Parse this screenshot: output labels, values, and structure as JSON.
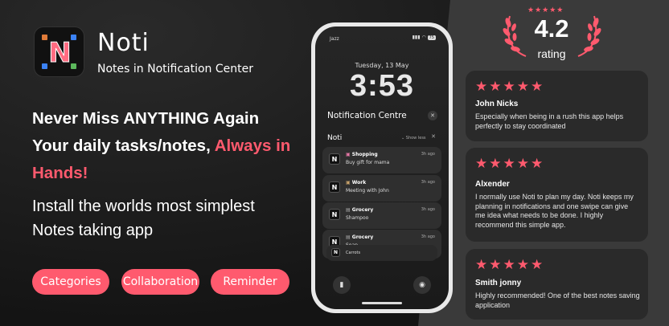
{
  "app": {
    "icon_letter": "N",
    "name": "Noti",
    "subtitle": "Notes in Notification Center"
  },
  "headline": {
    "line1": "Never Miss ANYTHING Again",
    "line2_plain": "Your daily tasks/notes, ",
    "line2_accent": "Always in Hands!"
  },
  "tagline": "Install the worlds most simplest Notes taking app",
  "pills": [
    "Categories",
    "Collaboration",
    "Reminder"
  ],
  "phone": {
    "carrier": "Jazz",
    "battery": "75",
    "date": "Tuesday, 13 May",
    "time": "3:53",
    "notification_centre": "Notification Centre",
    "group_title": "Noti",
    "show_less": "Show less",
    "notifications": [
      {
        "category": "Shopping",
        "body": "Buy gift for mama",
        "time": "3h ago"
      },
      {
        "category": "Work",
        "body": "Meeting with John",
        "time": "3h ago"
      },
      {
        "category": "Grocery",
        "body": "Shampoo",
        "time": "3h ago"
      },
      {
        "category": "Grocery",
        "body": "Soap",
        "time": "3h ago"
      },
      {
        "category": "",
        "body": "Carrots",
        "time": ""
      }
    ]
  },
  "rating": {
    "value": "4.2",
    "label": "rating",
    "stars": "★★★★★"
  },
  "reviews": [
    {
      "stars": "★★★★★",
      "name": "John Nicks",
      "text": "Especially when being in a rush this app helps perfectly to stay coordinated"
    },
    {
      "stars": "★★★★★",
      "name": "Alxender",
      "text": "I normally use Noti to plan my day. Noti keeps my planning in notifications and one swipe can give me idea what needs to be done. I highly recommend this simple app."
    },
    {
      "stars": "★★★★★",
      "name": "Smith jonny",
      "text": "Highly recommended! One of the best notes saving application"
    }
  ],
  "colors": {
    "accent": "#ff5a6e",
    "background": "#1c1c1c",
    "card": "#2a2a2a"
  }
}
